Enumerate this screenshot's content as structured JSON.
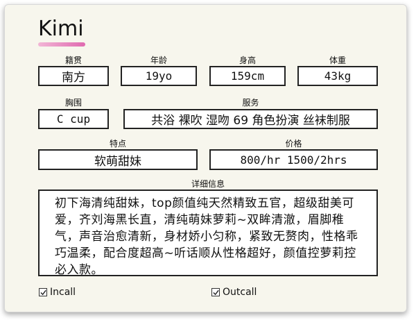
{
  "profile": {
    "name": "Kimi",
    "fields": {
      "origin": {
        "label": "籍贯",
        "value": "南方"
      },
      "age": {
        "label": "年龄",
        "value": "19yo"
      },
      "height": {
        "label": "身高",
        "value": "159cm"
      },
      "weight": {
        "label": "体重",
        "value": "43kg"
      },
      "bust": {
        "label": "胸围",
        "value": "C cup"
      },
      "services": {
        "label": "服务",
        "value": "共浴 裸吹 湿吻 69 角色扮演 丝袜制服"
      },
      "traits": {
        "label": "特点",
        "value": "软萌甜妹"
      },
      "price": {
        "label": "价格",
        "value": "800/hr 1500/2hrs"
      }
    },
    "details": {
      "label": "详细信息",
      "text": "初下海清纯甜妹，top颜值纯天然精致五官，超级甜美可爱，齐刘海黑长直，清纯萌妹萝莉~双眸清澈，眉脚稚气，声音治愈清新，身材娇小匀称，紧致无赘肉，性格乖巧温柔，配合度超高~听话顺从性格超好，颜值控萝莉控必入款。"
    },
    "options": {
      "incall": {
        "label": "Incall",
        "checked": true
      },
      "outcall": {
        "label": "Outcall",
        "checked": true
      }
    }
  }
}
